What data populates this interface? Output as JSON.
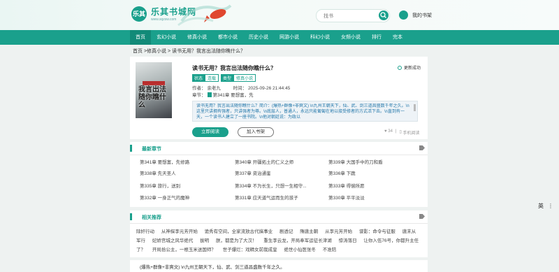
{
  "site": {
    "name": "乐其书城网",
    "domain": "www.sqzsw.com",
    "logo_mark": "乐其"
  },
  "search": {
    "placeholder": "找书"
  },
  "header": {
    "shelf_label": "我的书架"
  },
  "nav": {
    "items": [
      "首页",
      "玄幻小说",
      "修真小说",
      "都市小说",
      "历史小说",
      "网游小说",
      "科幻小说",
      "女频小说",
      "排行",
      "完本"
    ]
  },
  "breadcrumb": "首页 >修真小说 > 读书无用？我言出法随你瞧什么？",
  "book": {
    "title": "读书无用？我言出法随你瞧什么？",
    "update_status": "更新成功",
    "status_key": "状态",
    "status_val": "连载",
    "category_key": "类型",
    "category_val": "修真小说",
    "author_label": "作者：",
    "author": "余老九",
    "time_label": "时间：",
    "time": "2025-09-26 21:44:45",
    "chapter_label": "章节：",
    "chapter": "第341章 要想富，先",
    "intro": "读书无用？我言出法随你瞧什么？简介：(爆热+群像+非爽文) \\n九州王朝天下，仙、武、剑三道昌盛数千年之久。\\n这里只讲拥有强者，只讲强者为尊。\\n底层人，普通人，永远只能匍匐在地以接受修者的方式活下去。\\n直到有一天，一个读书人建立了一座书院。\\n他对朝廷说：为政以",
    "read_btn": "立即阅读",
    "shelf_btn": "加入书架",
    "likes": "34",
    "mobile_label": "手机阅读",
    "cover_title": "我言出法随你瞧什么"
  },
  "latest": {
    "title": "最新章节",
    "chapters": [
      "第341章 要想富，先修路",
      "第340章 开疆拓土的仁义之师",
      "第339章 大国手中的刀和盾",
      "第338章 先天圣人",
      "第337章 资治通鉴",
      "第336章 下跪",
      "第335章 旅行，送别",
      "第334章 不为长生，只想一生相守...",
      "第333章 得偿所愿",
      "第332章 一身正气的魔神",
      "第331章 应天道气运而生的孩子",
      "第330章 平平淡淡"
    ]
  },
  "recommend": {
    "title": "相关推荐",
    "items": [
      "除奸行动",
      "从神探李元芳开始",
      "诡秀有空间，全家流放古代搞事业",
      "剧透记",
      "隋唐主朝",
      "从李元芳开始",
      "谍影：命令与征服",
      "唐末从军行",
      "妃娇宫城之风华绝代",
      "拔明",
      "朕，都是为了大汉！",
      "重生李云龙，开局奉军运征长津湖",
      "惊涛落日",
      "让你入伍76号，你都升主任了？",
      "开局拾公主，一根玉米送国师？",
      "世子爆烂：戏精女前我成皇",
      "绝世小仙医张冬",
      "不准陪"
    ]
  },
  "bottom_text": "(爆热+群像+非爽文) \\n九州王朝天下，仙、武、剑三道昌盛数千年之久。",
  "lang_label": "英"
}
